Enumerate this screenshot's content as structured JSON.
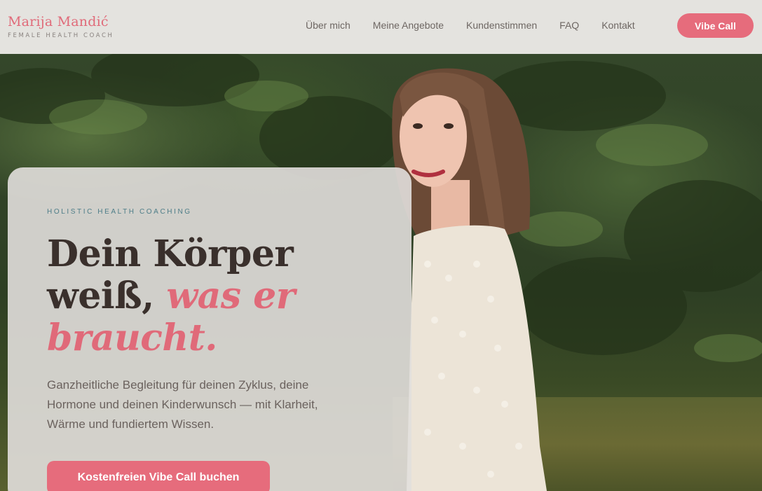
{
  "brand": {
    "name": "Marija Mandić",
    "subtitle": "FEMALE HEALTH COACH"
  },
  "nav": {
    "items": [
      "Über mich",
      "Meine Angebote",
      "Kundenstimmen",
      "FAQ",
      "Kontakt"
    ],
    "cta": "Vibe Call"
  },
  "hero": {
    "eyebrow": "HOLISTIC HEALTH COACHING",
    "headline_line1": "Dein Körper",
    "headline_line2_plain": "weiß, ",
    "headline_line2_accent": "was er",
    "headline_line3_accent": "braucht.",
    "subtext": "Ganzheitliche Begleitung für deinen Zyklus, deine Hormone und deinen Kinderwunsch — mit Klarheit, Wärme und fundiertem Wissen.",
    "cta": "Kostenfreien Vibe Call buchen"
  },
  "colors": {
    "accent": "#e66c7c",
    "brand_pink": "#e06a79",
    "eyebrow_teal": "#4d7d88",
    "header_bg": "#e4e3df",
    "headline_dark": "#3a302c"
  },
  "icons": {
    "hero_photo": "photo-of-woman-in-garden"
  }
}
